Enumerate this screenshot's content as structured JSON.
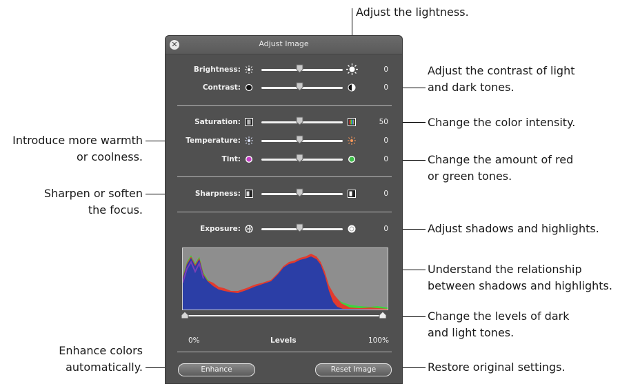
{
  "window": {
    "title": "Adjust Image"
  },
  "sections": [
    {
      "label": "Brightness:",
      "value": "0",
      "left_icon": "sun-small-icon",
      "right_icon": "sun-large-icon"
    },
    {
      "label": "Contrast:",
      "value": "0",
      "left_icon": "contrast-low-icon",
      "right_icon": "contrast-high-icon"
    },
    {
      "label": "Saturation:",
      "value": "50",
      "left_icon": "saturation-low-icon",
      "right_icon": "saturation-high-icon"
    },
    {
      "label": "Temperature:",
      "value": "0",
      "left_icon": "temperature-cool-icon",
      "right_icon": "temperature-warm-icon"
    },
    {
      "label": "Tint:",
      "value": "0",
      "left_icon": "tint-magenta-icon",
      "right_icon": "tint-green-icon"
    },
    {
      "label": "Sharpness:",
      "value": "0",
      "left_icon": "sharpness-soft-icon",
      "right_icon": "sharpness-sharp-icon"
    },
    {
      "label": "Exposure:",
      "value": "0",
      "left_icon": "exposure-low-icon",
      "right_icon": "exposure-high-icon"
    }
  ],
  "levels": {
    "label": "Levels",
    "min_label": "0%",
    "max_label": "100%"
  },
  "buttons": {
    "enhance": "Enhance",
    "reset": "Reset Image"
  },
  "callouts": {
    "lightness": "Adjust the lightness.",
    "contrast_1": "Adjust the contrast of light",
    "contrast_2": "and dark tones.",
    "saturation": "Change the color intensity.",
    "tint_1": "Change the amount of red",
    "tint_2": "or green tones.",
    "exposure": "Adjust shadows and highlights.",
    "histogram_1": "Understand the relationship",
    "histogram_2": "between shadows and highlights.",
    "levels_1": "Change the levels of dark",
    "levels_2": "and light tones.",
    "reset": "Restore original settings.",
    "temperature_1": "Introduce more warmth",
    "temperature_2": "or coolness.",
    "sharpness_1": "Sharpen or soften",
    "sharpness_2": "the focus.",
    "enhance_1": "Enhance colors",
    "enhance_2": "automatically."
  },
  "colors": {
    "panel": "#505050",
    "histogram_fill": "#2b3ea6",
    "histogram_green": "#3fd23f",
    "histogram_red": "#e23b2e",
    "histogram_bg": "#8e8e8e"
  }
}
